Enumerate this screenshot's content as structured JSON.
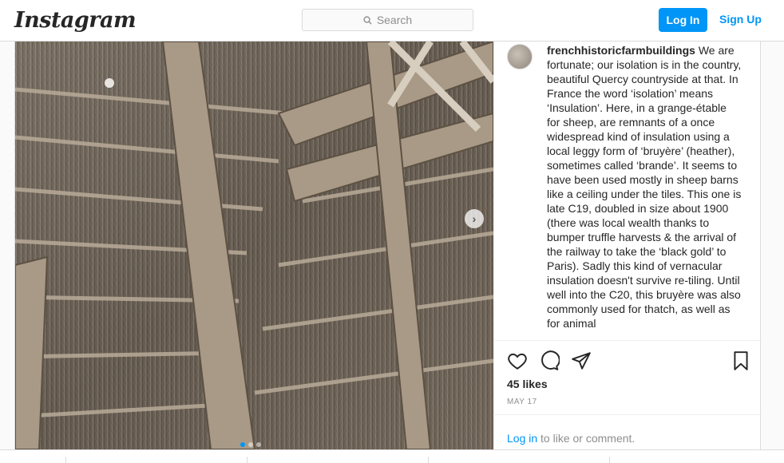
{
  "header": {
    "logo": "Instagram",
    "search_placeholder": "Search",
    "login_label": "Log In",
    "signup_label": "Sign Up"
  },
  "post": {
    "username": "frenchhistoricfarmbuildings",
    "caption": "We are fortunate; our isolation is in the country, beautiful Quercy countryside at that. In France the word ‘isolation’ means ‘Insulation’. Here, in a grange-étable for sheep, are remnants of a once widespread kind of insulation using a local leggy form of ‘bruyère’ (heather), sometimes called ‘brande’. It seems to have been used mostly in sheep barns like a ceiling under the tiles. This one is late C19, doubled in size about 1900 (there was local wealth thanks to bumper truffle harvests & the arrival of the railway to take the ‘black gold’ to Paris). Sadly this kind of vernacular insulation doesn't survive re-tiling. Until well into the C20, this bruyère was also commonly used for thatch, as well as for animal",
    "likes": "45 likes",
    "date": "MAY 17",
    "login_link": "Log in",
    "login_suffix": " to like or comment.",
    "carousel_slides": 3,
    "active_slide": 1
  },
  "icons": [
    "search-icon",
    "heart-icon",
    "comment-icon",
    "share-icon",
    "bookmark-icon",
    "chevron-right-icon"
  ],
  "colors": {
    "accent": "#0095f6",
    "text": "#262626",
    "muted": "#8e8e8e",
    "border": "#dbdbdb"
  }
}
